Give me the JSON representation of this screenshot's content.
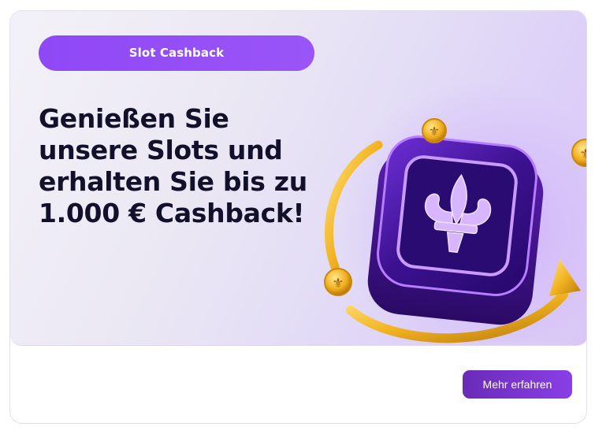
{
  "promo": {
    "badge_label": "Slot Cashback",
    "headline": "Genießen Sie unsere Slots und erhalten Sie bis zu 1.000 € Cashback!",
    "cta_label": "Mehr erfahren",
    "illustration_icon": "fleur-de-lis-slot-tile-icon",
    "colors": {
      "accent": "#9450F7",
      "cta": "#7A35D0",
      "headline": "#12102A",
      "gold": "#F2B321"
    }
  }
}
